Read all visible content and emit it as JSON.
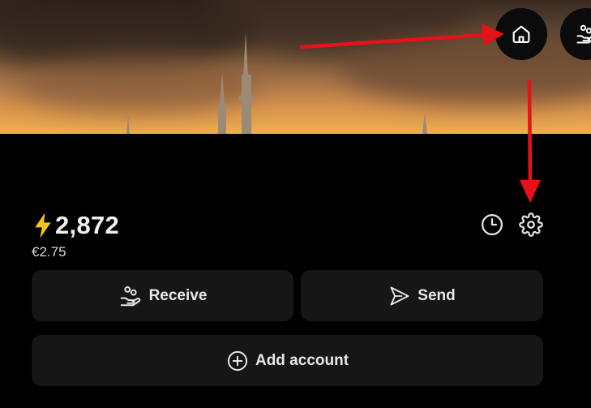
{
  "header": {
    "home_button_icon": "home-icon",
    "receive_shortcut_icon": "hand-coins-icon"
  },
  "wallet": {
    "balance_icon": "lightning-bolt-icon",
    "balance": "2,872",
    "fiat_value": "€2.75",
    "history_icon": "clock-icon",
    "settings_icon": "gear-icon"
  },
  "actions": {
    "receive_label": "Receive",
    "receive_icon": "hand-coins-icon",
    "send_label": "Send",
    "send_icon": "paper-plane-icon",
    "add_account_label": "Add account",
    "add_account_icon": "plus-circle-icon"
  },
  "colors": {
    "background": "#000000",
    "button_background": "#161616",
    "bolt": "#f5c518",
    "annotation_arrow": "#e8111a"
  }
}
